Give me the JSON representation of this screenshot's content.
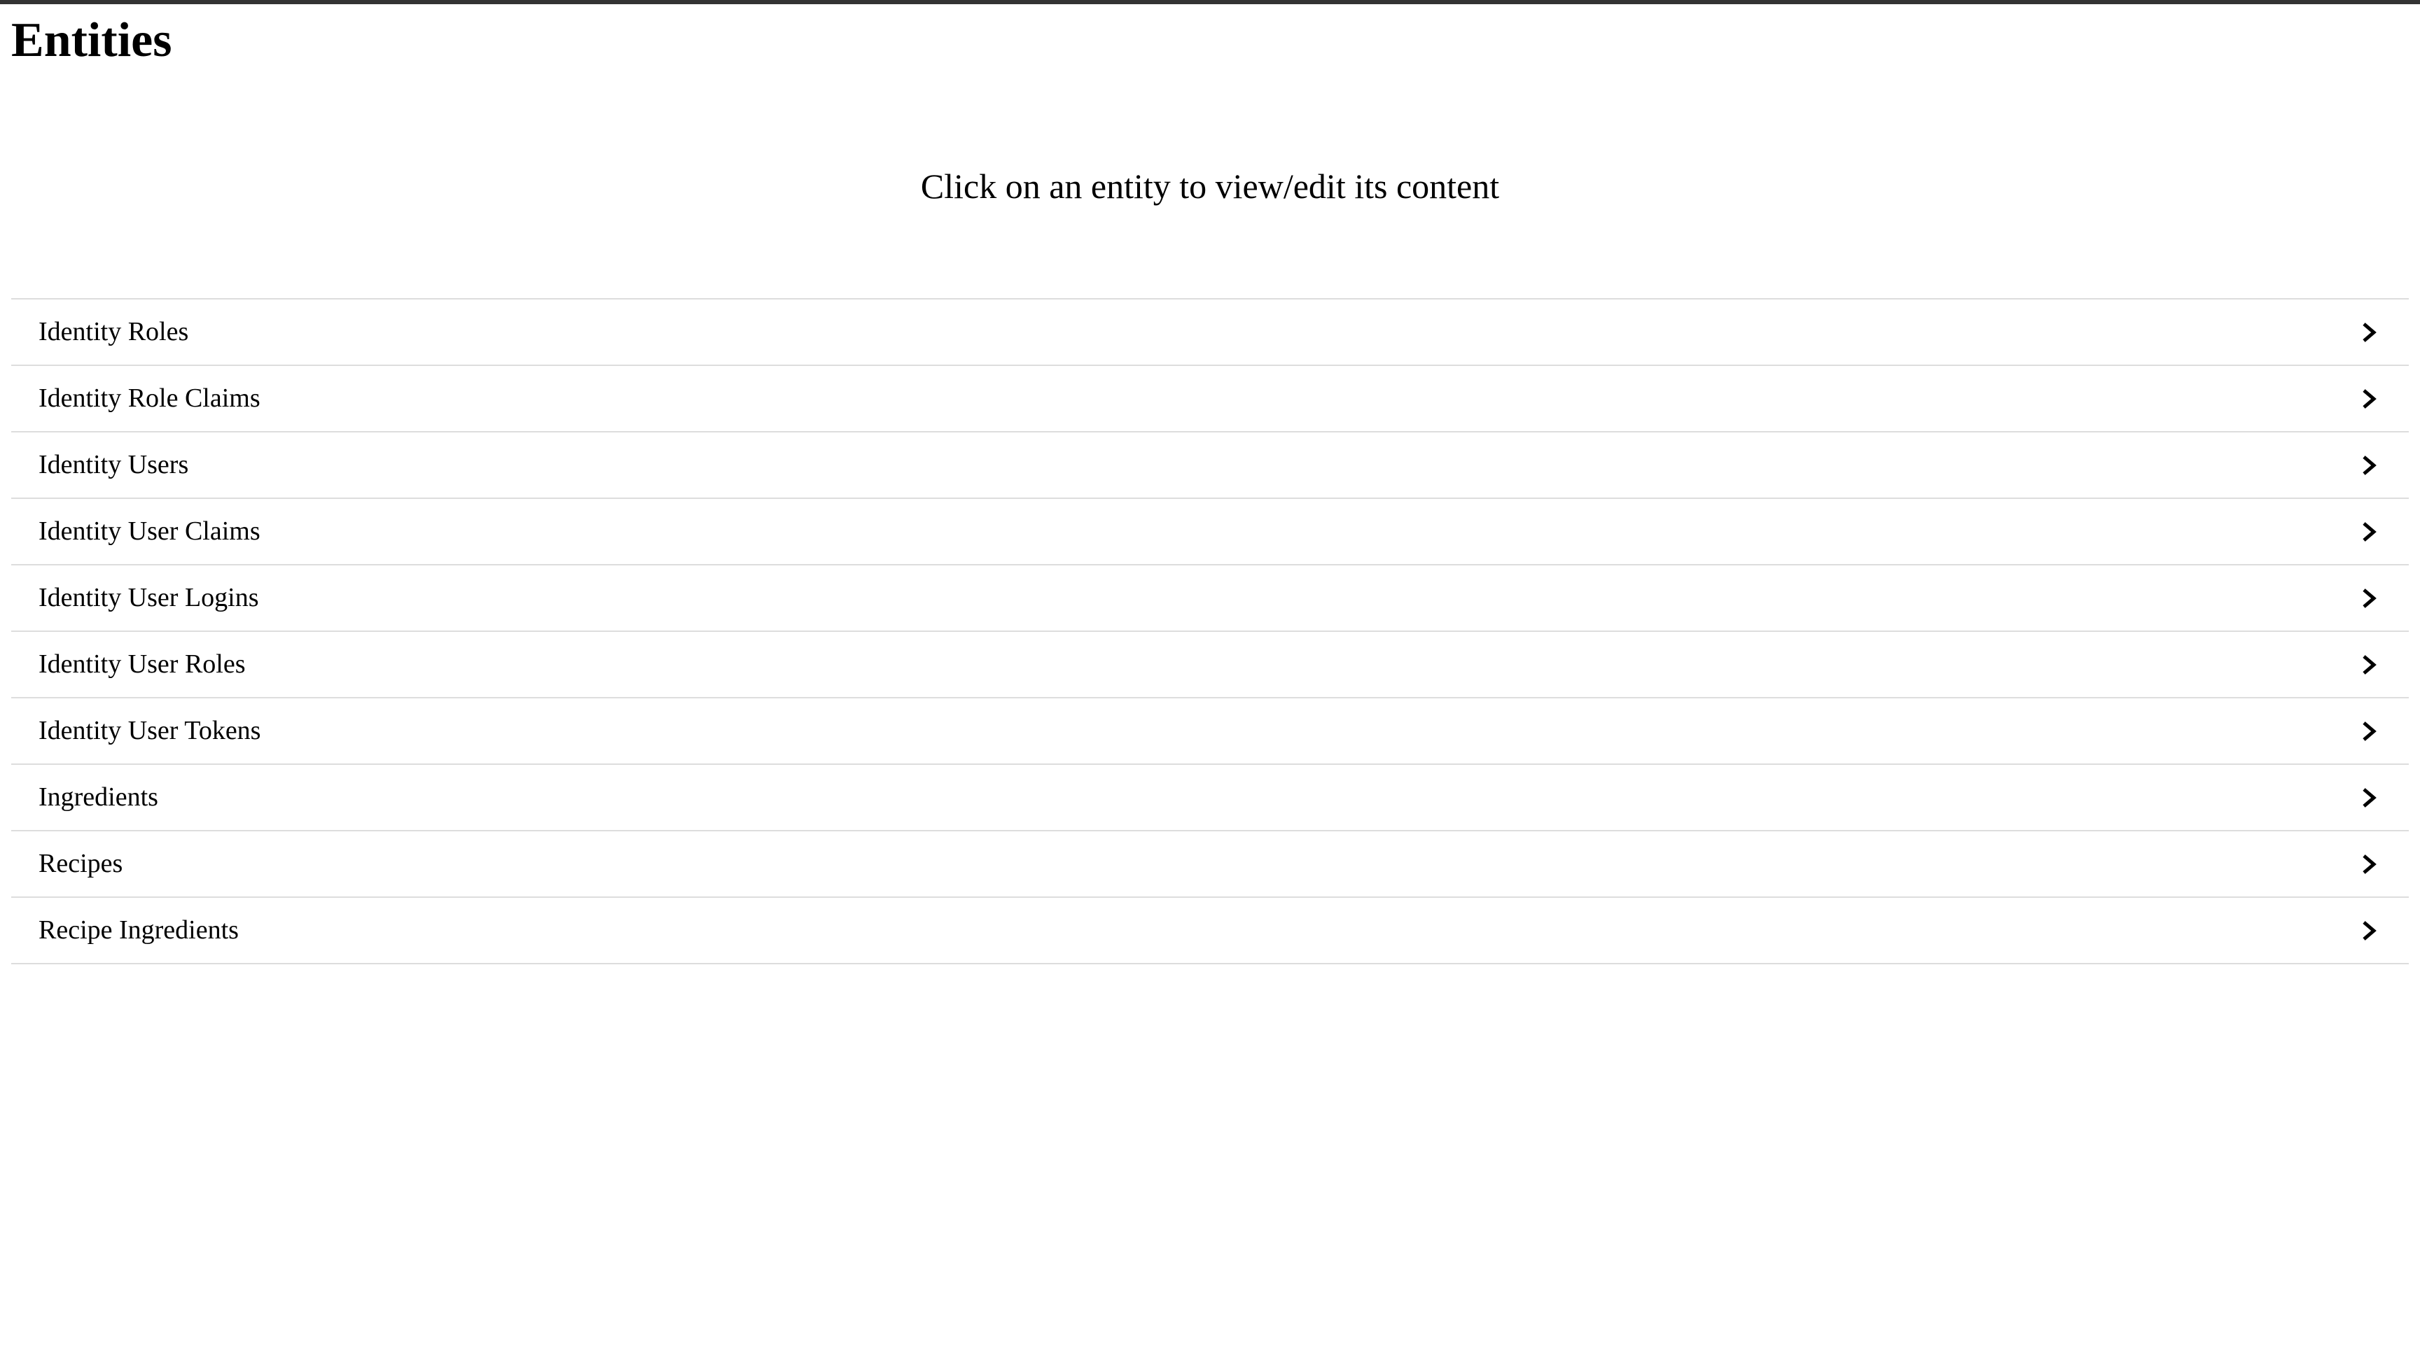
{
  "header": {
    "title": "Entities"
  },
  "subtitle": "Click on an entity to view/edit its content",
  "entities": [
    {
      "label": "Identity Roles"
    },
    {
      "label": "Identity Role Claims"
    },
    {
      "label": "Identity Users"
    },
    {
      "label": "Identity User Claims"
    },
    {
      "label": "Identity User Logins"
    },
    {
      "label": "Identity User Roles"
    },
    {
      "label": "Identity User Tokens"
    },
    {
      "label": "Ingredients"
    },
    {
      "label": "Recipes"
    },
    {
      "label": "Recipe Ingredients"
    }
  ],
  "icons": {
    "row_indicator": "chevron-right-icon"
  },
  "colors": {
    "top_bar": "#333333",
    "divider": "#dddddd",
    "text": "#000000",
    "background": "#ffffff"
  }
}
